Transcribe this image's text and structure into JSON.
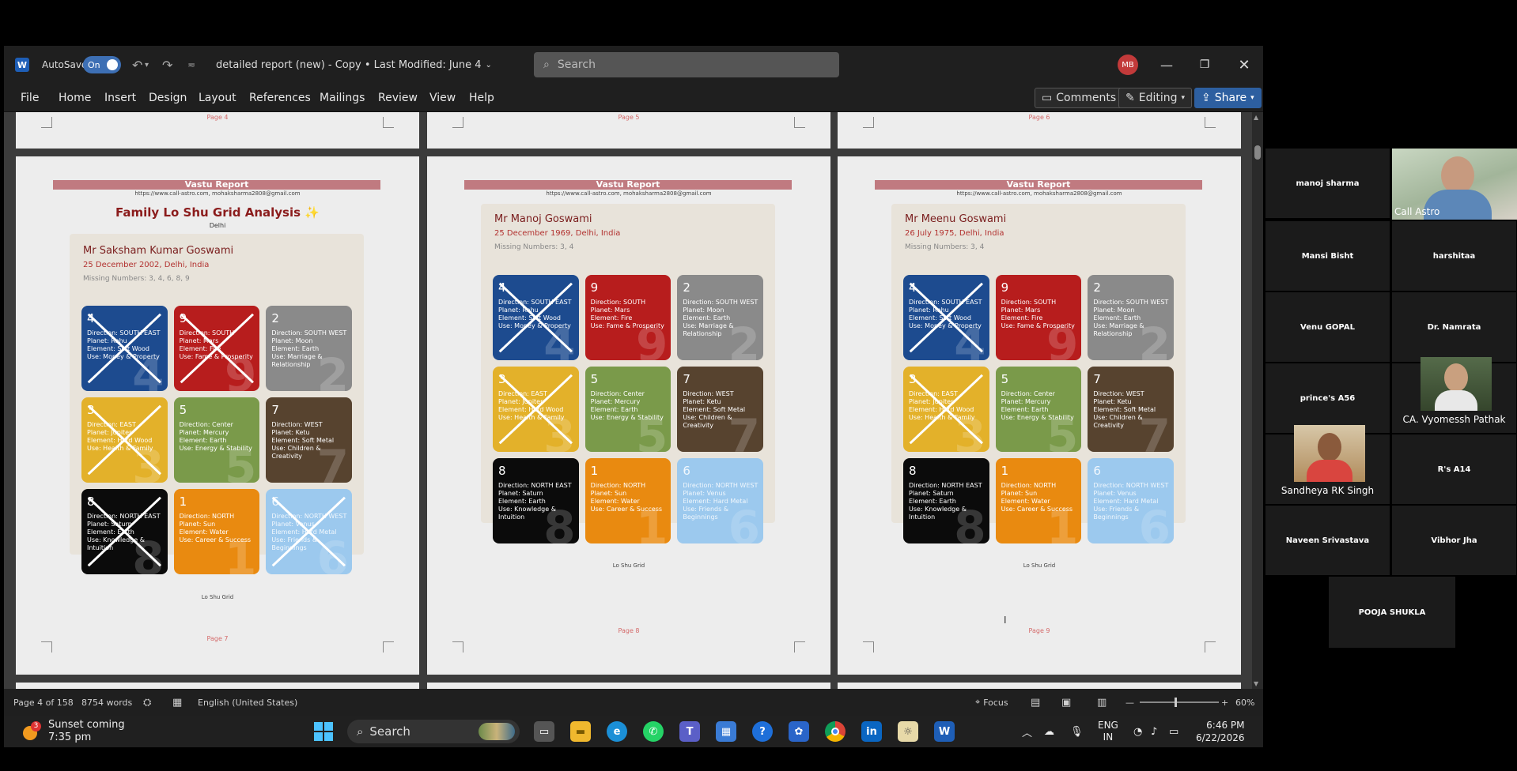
{
  "titlebar": {
    "autosave_label": "AutoSave",
    "autosave_state": "On",
    "doc_title": "detailed report (new) - Copy • Last Modified: June 4",
    "search_placeholder": "Search",
    "user_initials": "MB"
  },
  "ribbon": {
    "menus": [
      "File",
      "Home",
      "Insert",
      "Design",
      "Layout",
      "References",
      "Mailings",
      "Review",
      "View",
      "Help"
    ],
    "comments": "Comments",
    "editing": "Editing",
    "share": "Share"
  },
  "pages_top": [
    "Page 4",
    "Page 5",
    "Page 6"
  ],
  "report": {
    "header": "Vastu Report",
    "url": "https://www.call-astro.com, mohaksharma2808@gmail.com",
    "family_title": "Family Lo Shu Grid Analysis ✨",
    "family_city": "Delhi",
    "grid_caption": "Lo Shu Grid"
  },
  "pages_bottom": [
    "Page 7",
    "Page 8",
    "Page 9"
  ],
  "people": [
    {
      "name": "Mr Saksham Kumar Goswami",
      "date": "25 December 2002, Delhi, India",
      "missing": "Missing Numbers: 3, 4, 6, 8, 9",
      "missing_list": [
        3,
        4,
        6,
        8,
        9
      ]
    },
    {
      "name": "Mr Manoj Goswami",
      "date": "25 December 1969, Delhi, India",
      "missing": "Missing Numbers: 3, 4",
      "missing_list": [
        3,
        4
      ]
    },
    {
      "name": "Mr Meenu Goswami",
      "date": "26 July 1975, Delhi, India",
      "missing": "Missing Numbers: 3, 4",
      "missing_list": [
        3,
        4
      ]
    }
  ],
  "grid_cells": [
    {
      "n": "4",
      "color": "#1d4b8f",
      "dir": "Direction: SOUTH EAST",
      "planet": "Planet: Rahu",
      "element": "Element: Soft Wood",
      "use": "Use: Money & Property"
    },
    {
      "n": "9",
      "color": "#b71d1d",
      "dir": "Direction: SOUTH",
      "planet": "Planet: Mars",
      "element": "Element: Fire",
      "use": "Use: Fame & Prosperity"
    },
    {
      "n": "2",
      "color": "#8a8a8a",
      "dir": "Direction: SOUTH WEST",
      "planet": "Planet: Moon",
      "element": "Element: Earth",
      "use": "Use: Marriage & Relationship"
    },
    {
      "n": "3",
      "color": "#e3b12a",
      "dir": "Direction: EAST",
      "planet": "Planet: Jupiter",
      "element": "Element: Hard Wood",
      "use": "Use: Health & Family"
    },
    {
      "n": "5",
      "color": "#7a9a4a",
      "dir": "Direction: Center",
      "planet": "Planet: Mercury",
      "element": "Element: Earth",
      "use": "Use: Energy & Stability"
    },
    {
      "n": "7",
      "color": "#57432f",
      "dir": "Direction: WEST",
      "planet": "Planet: Ketu",
      "element": "Element: Soft Metal",
      "use": "Use: Children & Creativity"
    },
    {
      "n": "8",
      "color": "#0b0b0b",
      "dir": "Direction: NORTH EAST",
      "planet": "Planet: Saturn",
      "element": "Element: Earth",
      "use": "Use: Knowledge & Intuition"
    },
    {
      "n": "1",
      "color": "#e98a10",
      "dir": "Direction: NORTH",
      "planet": "Planet: Sun",
      "element": "Element: Water",
      "use": "Use: Career & Success"
    },
    {
      "n": "6",
      "color": "#9cc9ee",
      "dir": "Direction: NORTH WEST",
      "planet": "Planet: Venus",
      "element": "Element: Hard Metal",
      "use": "Use: Friends & Beginnings"
    }
  ],
  "statusbar": {
    "page": "Page 4 of 158",
    "words": "8754 words",
    "language": "English (United States)",
    "focus": "Focus",
    "zoom": "60%"
  },
  "taskbar": {
    "weather_title": "Sunset coming",
    "weather_time": "7:35 pm",
    "weather_badge": "3",
    "search": "Search",
    "lang1": "ENG",
    "lang2": "IN",
    "time": "6:46 PM",
    "date": "6/22/2026"
  },
  "participants": {
    "manoj": "manoj sharma",
    "call_astro": "Call Astro",
    "mansi": "Mansi Bisht",
    "harshitaa": "harshitaa",
    "venu": "Venu GOPAL",
    "namrata": "Dr. Namrata",
    "prince": "prince's A56",
    "vyomessh": "CA. Vyomessh Pathak",
    "sandheya": "Sandheya RK Singh",
    "rs": "R's A14",
    "naveen": "Naveen Srivastava",
    "vibhor": "Vibhor Jha",
    "pooja": "POOJA SHUKLA"
  }
}
